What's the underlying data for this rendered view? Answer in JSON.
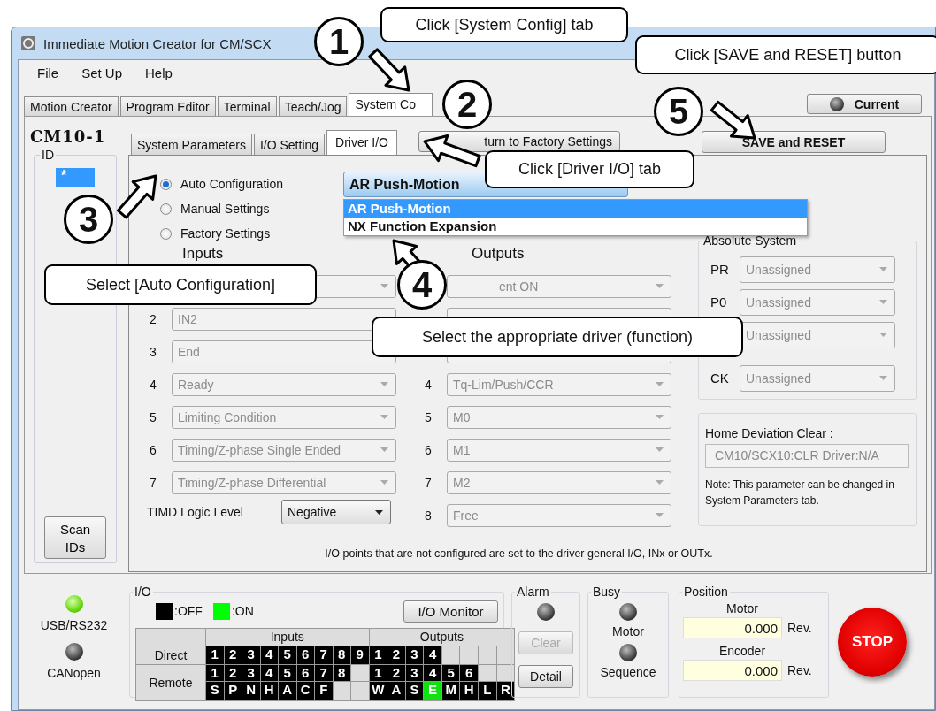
{
  "window": {
    "title": "Immediate Motion Creator for CM/SCX"
  },
  "menu": [
    "File",
    "Set Up",
    "Help"
  ],
  "tabs": [
    {
      "label": "Motion Creator",
      "selected": false
    },
    {
      "label": "Program Editor",
      "selected": false
    },
    {
      "label": "Terminal",
      "selected": false
    },
    {
      "label": "Teach/Jog",
      "selected": false
    },
    {
      "label": "System Co",
      "selected": true
    }
  ],
  "current_button": {
    "label": "Current",
    "on": false
  },
  "device": {
    "name": "CM10-1",
    "id_title": "ID",
    "ids": [
      {
        "label": "*",
        "selected": true
      }
    ],
    "scan_button": "Scan IDs"
  },
  "subtabs": [
    {
      "label": "System Parameters",
      "selected": false
    },
    {
      "label": "I/O Setting",
      "selected": false
    },
    {
      "label": "Driver I/O",
      "selected": true
    }
  ],
  "factory_button": "turn to Factory Settings",
  "save_button": "SAVE and RESET",
  "modes": [
    {
      "label": "Auto Configuration",
      "selected": true
    },
    {
      "label": "Manual Settings",
      "selected": false
    },
    {
      "label": "Factory Settings",
      "selected": false
    }
  ],
  "driver_select": {
    "value": "AR Push-Motion",
    "options": [
      {
        "label": "AR Push-Motion",
        "selected": true
      },
      {
        "label": "NX Function Expansion",
        "selected": false
      }
    ]
  },
  "inputs": {
    "title": "Inputs",
    "rows": [
      {
        "disabled": true
      },
      {
        "number": "2",
        "value": "IN2",
        "disabled": true
      },
      {
        "number": "3",
        "value": "End",
        "disabled": true
      },
      {
        "number": "4",
        "value": "Ready",
        "disabled": true
      },
      {
        "number": "5",
        "value": "Limiting Condition",
        "disabled": true
      },
      {
        "number": "6",
        "value": "Timing/Z-phase Single Ended",
        "disabled": true
      },
      {
        "number": "7",
        "value": "Timing/Z-phase Differential",
        "disabled": true
      }
    ]
  },
  "timd": {
    "label": "TIMD Logic Level",
    "value": "Negative",
    "disabled": false
  },
  "outputs": {
    "title": "Outputs",
    "rows": [
      {
        "value": "ent ON",
        "disabled": true
      },
      {
        "disabled": true
      },
      {
        "disabled": true
      },
      {
        "number": "4",
        "value": "Tq-Lim/Push/CCR",
        "disabled": true
      },
      {
        "number": "5",
        "value": "M0",
        "disabled": true
      },
      {
        "number": "6",
        "value": "M1",
        "disabled": true
      },
      {
        "number": "7",
        "value": "M2",
        "disabled": true
      },
      {
        "number": "8",
        "value": "Free",
        "disabled": true
      }
    ]
  },
  "absolute_system": {
    "title": "Absolute System",
    "rows": [
      {
        "label": "PR",
        "value": "Unassigned",
        "disabled": true
      },
      {
        "label": "P0",
        "value": "Unassigned",
        "disabled": true
      },
      {
        "value": "Unassigned",
        "disabled": true
      },
      {
        "label": "CK",
        "value": "Unassigned",
        "disabled": true
      }
    ]
  },
  "home_deviation": {
    "title": "Home Deviation Clear :",
    "value": "CM10/SCX10:CLR Driver:N/A",
    "disabled": true,
    "note": "Note: This parameter can be changed in System Parameters tab."
  },
  "footnote": "I/O points that are not configured are set to the driver general I/O, INx or OUTx.",
  "connections": [
    {
      "label": "USB/RS232",
      "on": true
    },
    {
      "label": "CANopen",
      "on": false
    }
  ],
  "io": {
    "title": "I/O",
    "legend": [
      {
        "label": ":OFF",
        "on": false
      },
      {
        "label": ":ON",
        "on": true
      }
    ],
    "monitor_button": "I/O Monitor",
    "columns": [
      "Inputs",
      "Outputs"
    ],
    "direct": {
      "label": "Direct",
      "inputs": [
        {
          "text": "1",
          "on": false
        },
        {
          "text": "2",
          "on": false
        },
        {
          "text": "3",
          "on": false
        },
        {
          "text": "4",
          "on": false
        },
        {
          "text": "5",
          "on": false
        },
        {
          "text": "6",
          "on": false
        },
        {
          "text": "7",
          "on": false
        },
        {
          "text": "8",
          "on": false
        },
        {
          "text": "9",
          "on": false
        }
      ],
      "outputs": [
        {
          "text": "1",
          "on": false
        },
        {
          "text": "2",
          "on": false
        },
        {
          "text": "3",
          "on": false
        },
        {
          "text": "4",
          "on": false
        }
      ]
    },
    "remote": {
      "label": "Remote",
      "lines": [
        {
          "inputs": [
            {
              "text": "1",
              "on": false
            },
            {
              "text": "2",
              "on": false
            },
            {
              "text": "3",
              "on": false
            },
            {
              "text": "4",
              "on": false
            },
            {
              "text": "5",
              "on": false
            },
            {
              "text": "6",
              "on": false
            },
            {
              "text": "7",
              "on": false
            },
            {
              "text": "8",
              "on": false
            }
          ],
          "outputs": [
            {
              "text": "1",
              "on": false
            },
            {
              "text": "2",
              "on": false
            },
            {
              "text": "3",
              "on": false
            },
            {
              "text": "4",
              "on": false
            },
            {
              "text": "5",
              "on": false
            },
            {
              "text": "6",
              "on": false
            }
          ]
        },
        {
          "inputs": [
            {
              "text": "S",
              "on": false
            },
            {
              "text": "P",
              "on": false
            },
            {
              "text": "N",
              "on": false
            },
            {
              "text": "H",
              "on": false
            },
            {
              "text": "A",
              "on": false
            },
            {
              "text": "C",
              "on": false
            },
            {
              "text": "F",
              "on": false
            }
          ],
          "outputs": [
            {
              "text": "W",
              "on": false
            },
            {
              "text": "A",
              "on": false
            },
            {
              "text": "S",
              "on": false
            },
            {
              "text": "E",
              "on": true
            },
            {
              "text": "M",
              "on": false
            },
            {
              "text": "H",
              "on": false
            },
            {
              "text": "L",
              "on": false
            },
            {
              "text": "R",
              "on": false
            }
          ]
        }
      ]
    }
  },
  "alarm": {
    "title": "Alarm",
    "on": false,
    "buttons": [
      {
        "label": "Clear",
        "disabled": true
      },
      {
        "label": "Detail",
        "disabled": false
      }
    ]
  },
  "busy": {
    "title": "Busy",
    "indicators": [
      {
        "label": "Motor",
        "on": false
      },
      {
        "label": "Sequence",
        "on": false
      }
    ]
  },
  "position": {
    "title": "Position",
    "readings": [
      {
        "label": "Motor",
        "value": "0.000",
        "unit": "Rev."
      },
      {
        "label": "Encoder",
        "value": "0.000",
        "unit": "Rev."
      }
    ]
  },
  "stop_button": "STOP",
  "annotations": [
    {
      "number": "1",
      "text": "Click [System Config] tab"
    },
    {
      "number": "2",
      "text": "Click [Driver I/O] tab"
    },
    {
      "number": "3",
      "text": "Select [Auto Configuration]"
    },
    {
      "number": "4",
      "text": "Select the appropriate driver (function)"
    },
    {
      "number": "5",
      "text": "Click [SAVE and RESET] button"
    }
  ]
}
